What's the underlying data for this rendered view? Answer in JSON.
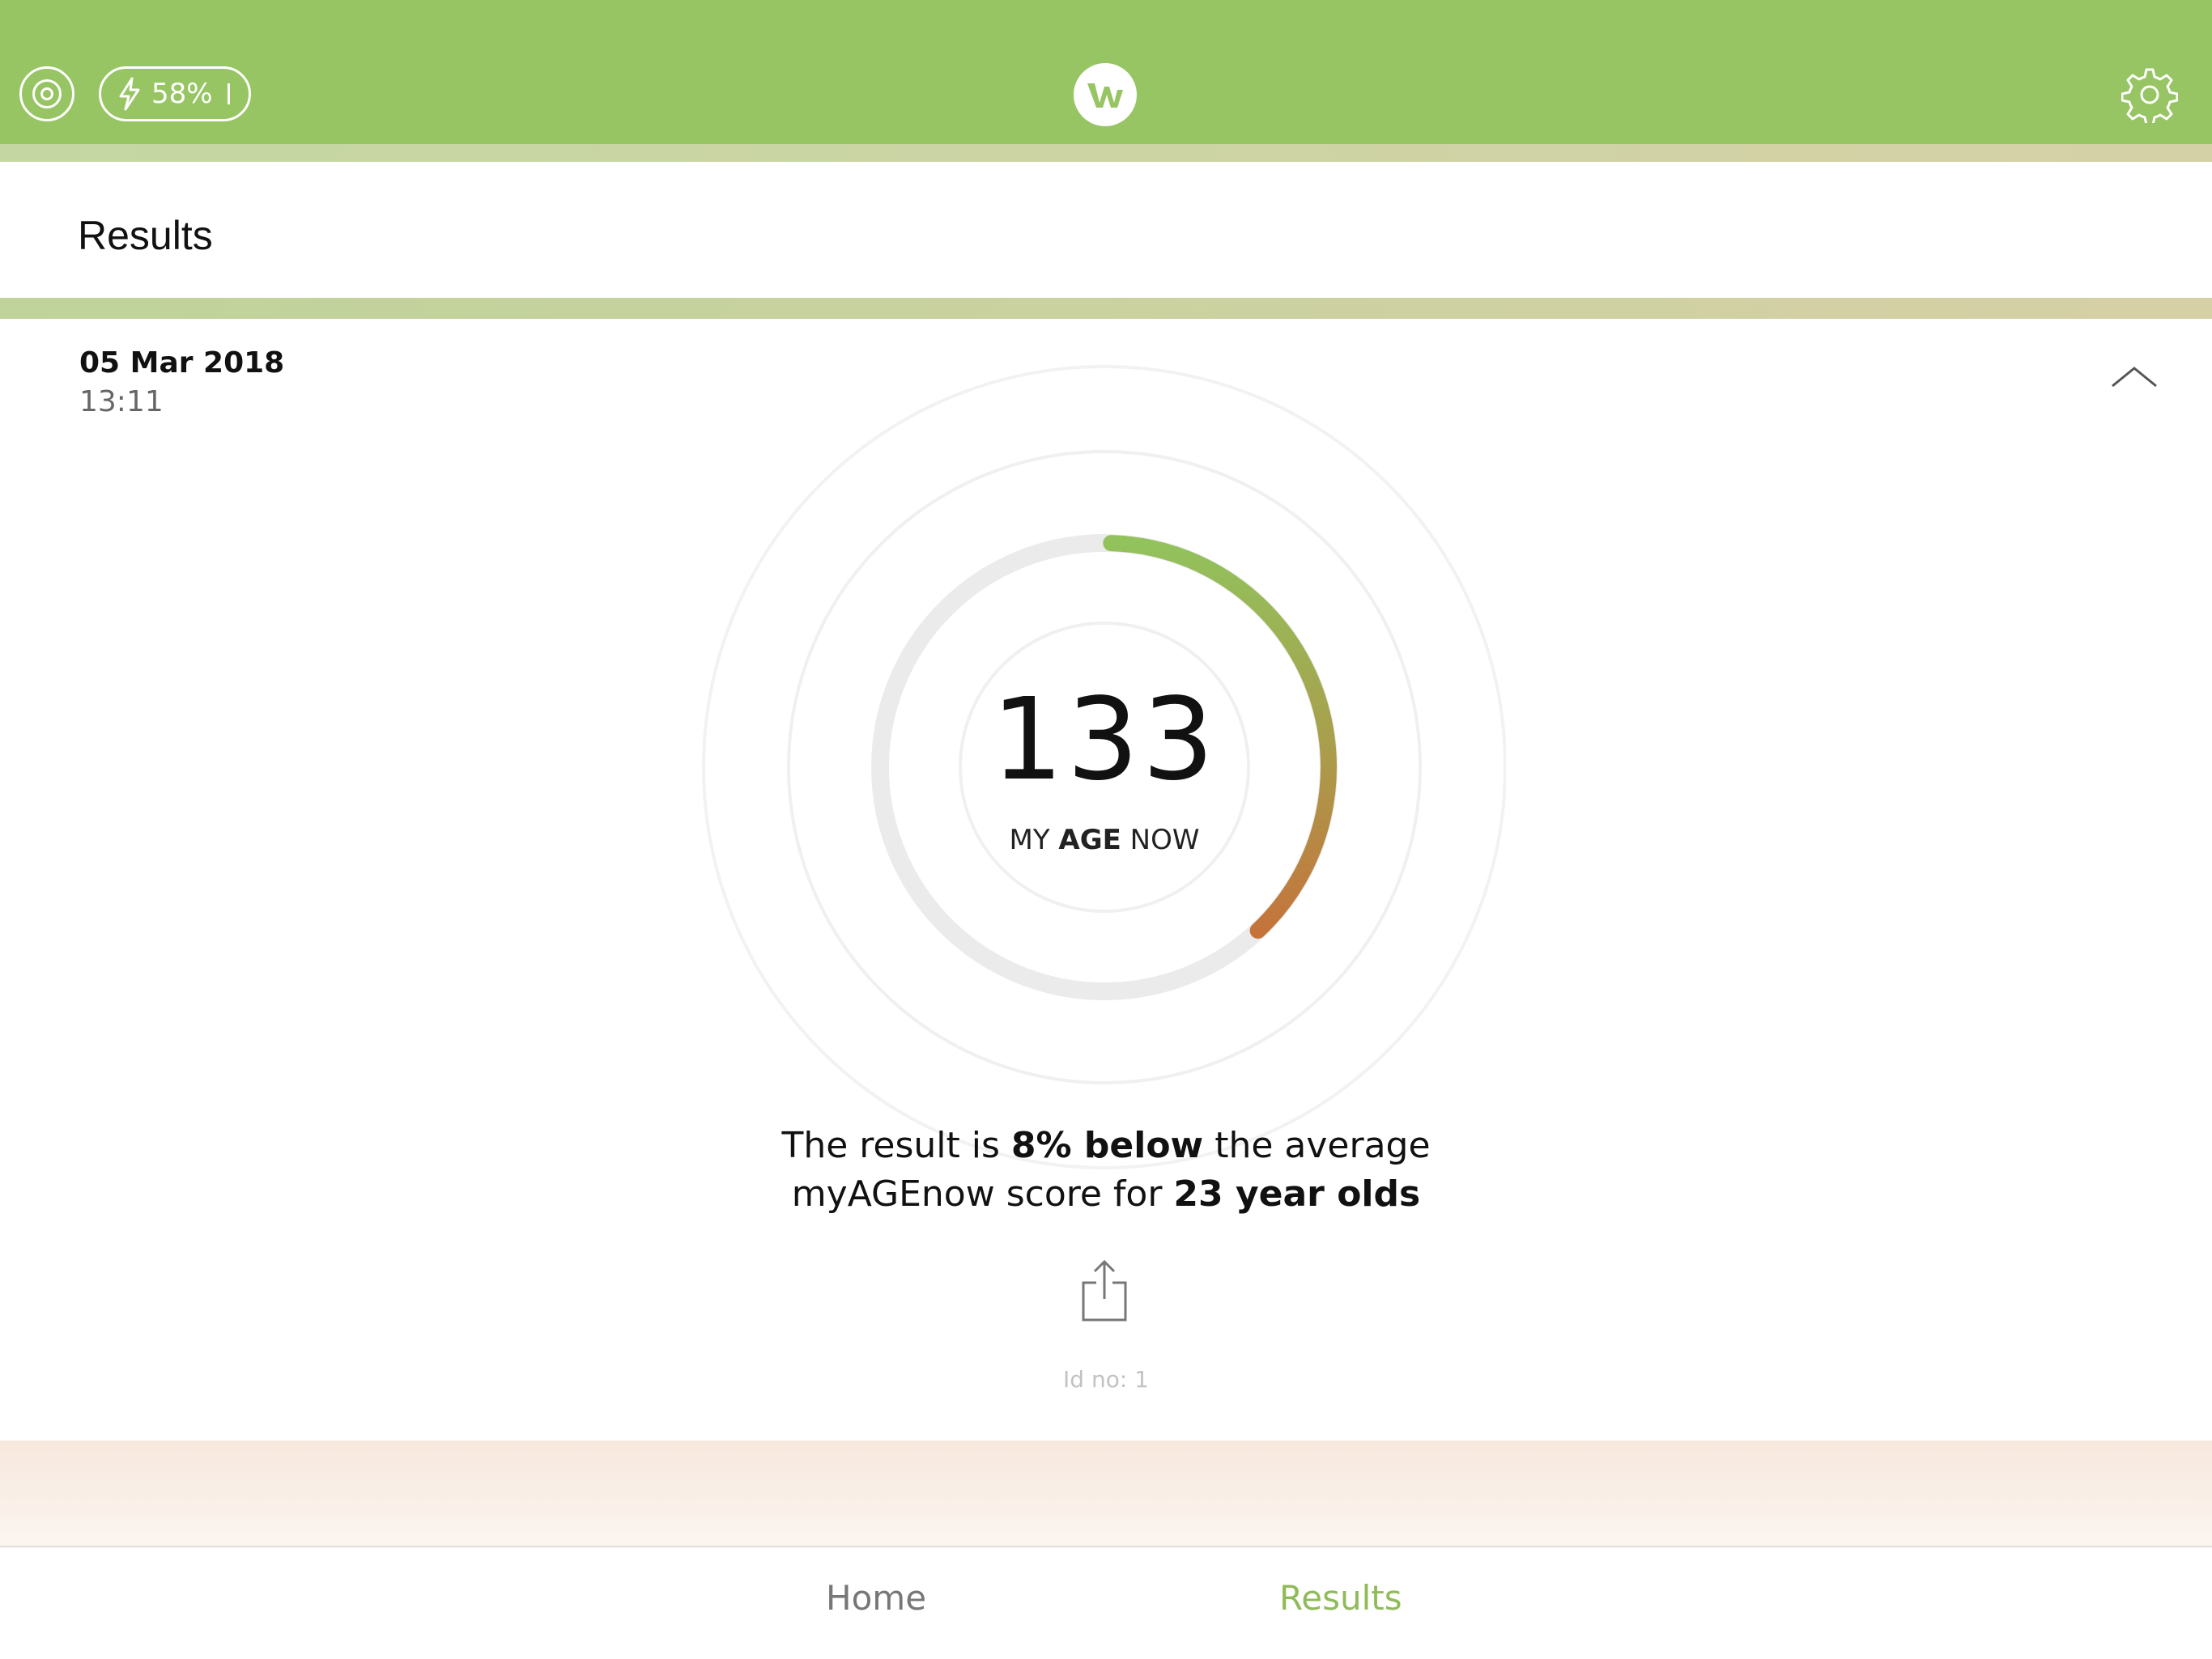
{
  "topbar": {
    "battery_label": "58%",
    "colors": {
      "bar": "#97c563",
      "accent": "#8fbb5a"
    }
  },
  "section": {
    "title": "Results"
  },
  "result": {
    "date": "05 Mar 2018",
    "time": "13:11",
    "score": "133",
    "age_label": {
      "prefix": "MY ",
      "bold": "AGE",
      "suffix": " NOW"
    },
    "gauge_fraction": 0.38,
    "message": {
      "line1_a": "The result is ",
      "line1_bold": "8% below",
      "line1_b": " the average",
      "line2_a": "myAGEnow score for ",
      "line2_bold": "23 year olds"
    },
    "id_label": "Id no: 1"
  },
  "tabs": [
    {
      "label": "Home",
      "active": false
    },
    {
      "label": "Results",
      "active": true
    }
  ]
}
